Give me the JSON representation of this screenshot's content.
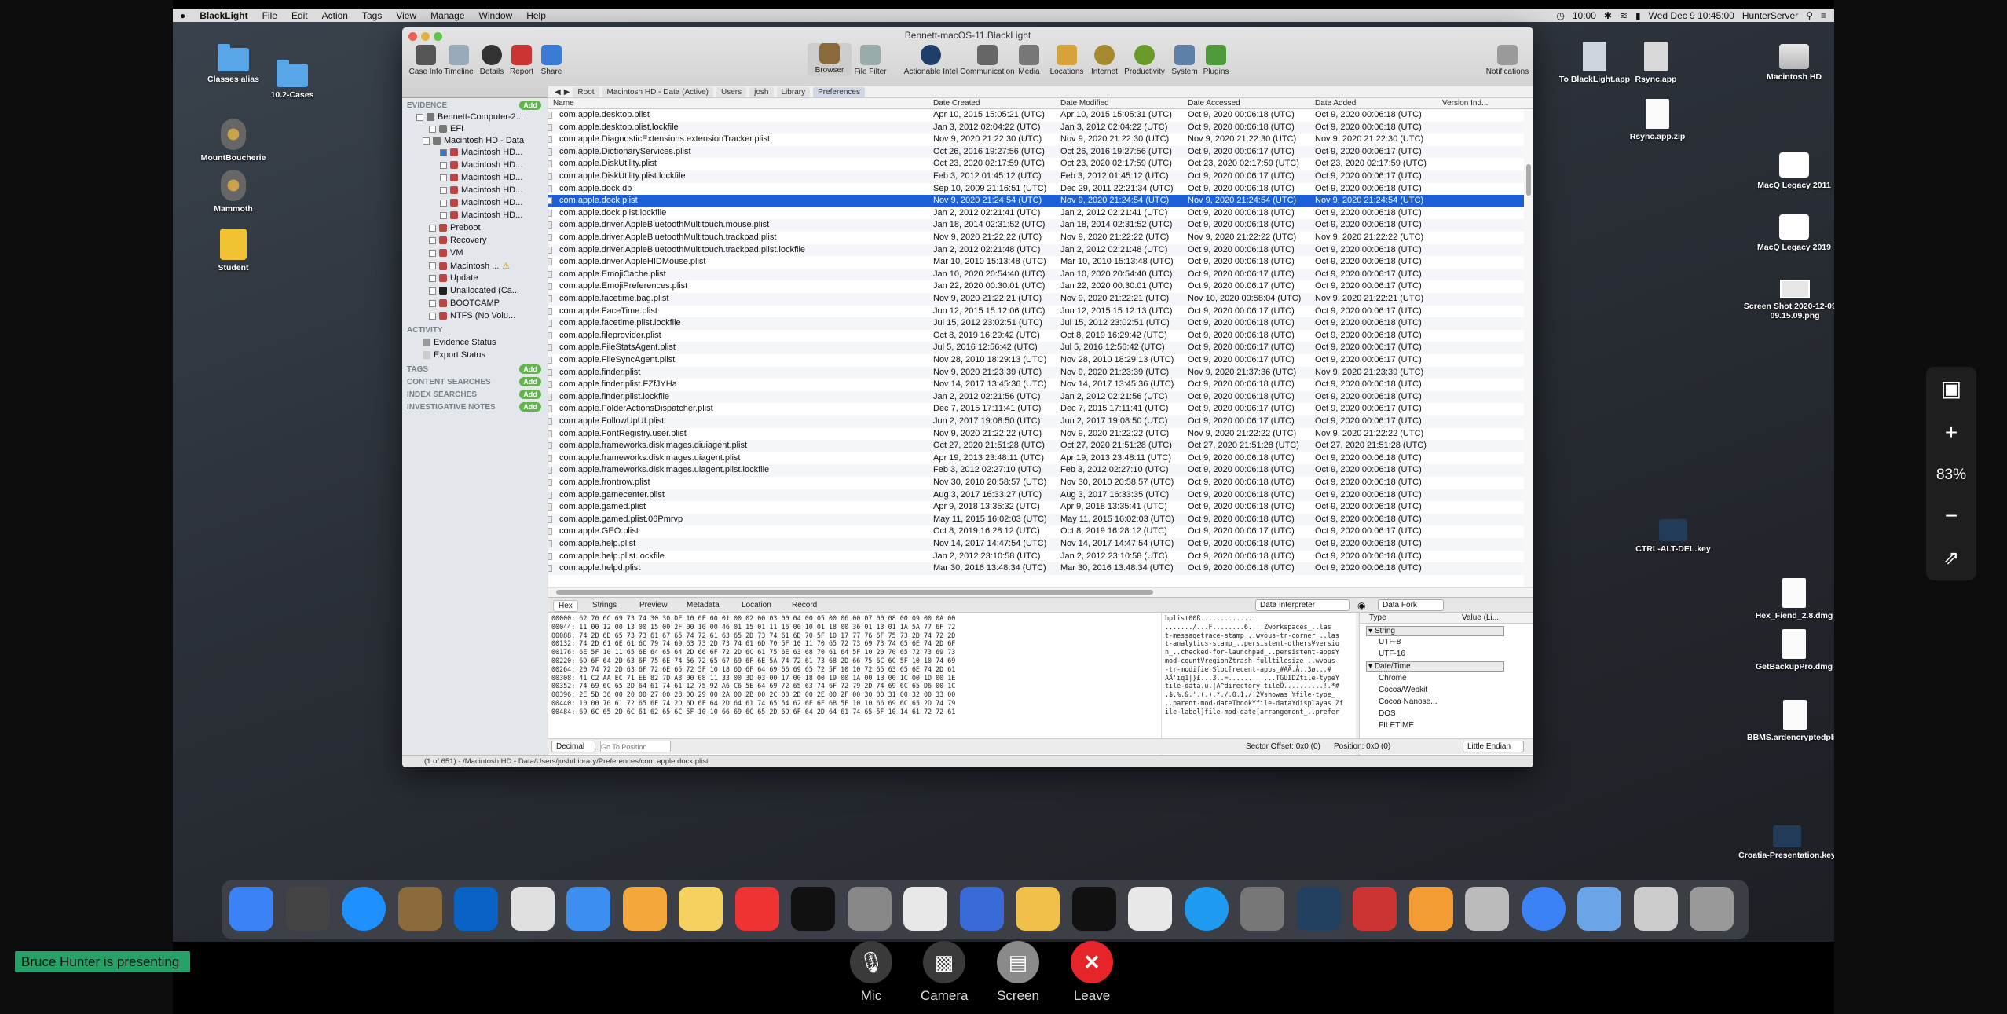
{
  "menubar": {
    "app": "BlackLight",
    "items": [
      "File",
      "Edit",
      "Action",
      "Tags",
      "View",
      "Manage",
      "Window",
      "Help"
    ],
    "clock": "10:00",
    "datetime": "Wed Dec 9  10:45:00",
    "user": "HunterServer"
  },
  "desktop_icons": {
    "classes_alias": "Classes alias",
    "cases": "10.2-Cases",
    "mountboucherie": "MountBoucherie",
    "mammoth": "Mammoth",
    "student": "Student",
    "to_blacklight": "To BlackLight.app",
    "rsync_app": "Rsync.app",
    "rsync_zip": "Rsync.app.zip",
    "macintosh_hd": "Macintosh HD",
    "macq2011": "MacQ Legacy 2011",
    "macq2019": "MacQ Legacy 2019",
    "screenshot": "Screen Shot 2020-12-09 at 09.15.09.png",
    "ctrl_alt_del": "CTRL-ALT-DEL.key",
    "hexfiend": "Hex_Fiend_2.8.dmg",
    "getbackup": "GetBackupPro.dmg",
    "bbms": "BBMS.ardencryptedplist",
    "croatia": "Croatia-Presentation.key"
  },
  "window": {
    "title": "Bennett-macOS-11.BlackLight",
    "toolbar_left": [
      "Case Info",
      "Timeline",
      "Details",
      "Report",
      "Share"
    ],
    "toolbar_mid": [
      "Browser",
      "File Filter",
      "Actionable Intel",
      "Communication",
      "Media",
      "Locations",
      "Internet",
      "Productivity",
      "System",
      "Plugins"
    ],
    "toolbar_right": "Notifications",
    "breadcrumbs": [
      "Root",
      "Macintosh HD - Data (Active)",
      "Users",
      "josh",
      "Library",
      "Preferences"
    ]
  },
  "sidebar": {
    "evidence": "EVIDENCE",
    "add": "Add",
    "tree": [
      "Bennett-Computer-2...",
      "EFI",
      "Macintosh HD - Data",
      "Macintosh HD...",
      "Macintosh HD...",
      "Macintosh HD...",
      "Macintosh HD...",
      "Macintosh HD...",
      "Macintosh HD...",
      "Preboot",
      "Recovery",
      "VM",
      "Macintosh ...",
      "Update",
      "Unallocated (Ca...",
      "BOOTCAMP",
      "NTFS (No Volu..."
    ],
    "activity": "ACTIVITY",
    "evidence_status": "Evidence Status",
    "export_status": "Export Status",
    "tags": "TAGS",
    "content_searches": "CONTENT SEARCHES",
    "index_searches": "INDEX SEARCHES",
    "investigative_notes": "INVESTIGATIVE NOTES"
  },
  "table": {
    "headers": [
      "Name",
      "Date Created",
      "Date Modified",
      "Date Accessed",
      "Date Added",
      "Version Ind..."
    ],
    "rows": [
      [
        "com.apple.desktop.plist",
        "Apr 10, 2015 15:05:21 (UTC)",
        "Apr 10, 2015 15:05:31 (UTC)",
        "Oct 9, 2020 00:06:18 (UTC)",
        "Oct 9, 2020 00:06:18 (UTC)"
      ],
      [
        "com.apple.desktop.plist.lockfile",
        "Jan 3, 2012 02:04:22 (UTC)",
        "Jan 3, 2012 02:04:22 (UTC)",
        "Oct 9, 2020 00:06:18 (UTC)",
        "Oct 9, 2020 00:06:18 (UTC)"
      ],
      [
        "com.apple.DiagnosticExtensions.extensionTracker.plist",
        "Nov 9, 2020 21:22:30 (UTC)",
        "Nov 9, 2020 21:22:30 (UTC)",
        "Nov 9, 2020 21:22:30 (UTC)",
        "Nov 9, 2020 21:22:30 (UTC)"
      ],
      [
        "com.apple.DictionaryServices.plist",
        "Oct 26, 2016 19:27:56 (UTC)",
        "Oct 26, 2016 19:27:56 (UTC)",
        "Oct 9, 2020 00:06:17 (UTC)",
        "Oct 9, 2020 00:06:17 (UTC)"
      ],
      [
        "com.apple.DiskUtility.plist",
        "Oct 23, 2020 02:17:59 (UTC)",
        "Oct 23, 2020 02:17:59 (UTC)",
        "Oct 23, 2020 02:17:59 (UTC)",
        "Oct 23, 2020 02:17:59 (UTC)"
      ],
      [
        "com.apple.DiskUtility.plist.lockfile",
        "Feb 3, 2012 01:45:12 (UTC)",
        "Feb 3, 2012 01:45:12 (UTC)",
        "Oct 9, 2020 00:06:17 (UTC)",
        "Oct 9, 2020 00:06:17 (UTC)"
      ],
      [
        "com.apple.dock.db",
        "Sep 10, 2009 21:16:51 (UTC)",
        "Dec 29, 2011 22:21:34 (UTC)",
        "Oct 9, 2020 00:06:18 (UTC)",
        "Oct 9, 2020 00:06:18 (UTC)"
      ],
      [
        "com.apple.dock.plist",
        "Nov 9, 2020 21:24:54 (UTC)",
        "Nov 9, 2020 21:24:54 (UTC)",
        "Nov 9, 2020 21:24:54 (UTC)",
        "Nov 9, 2020 21:24:54 (UTC)"
      ],
      [
        "com.apple.dock.plist.lockfile",
        "Jan 2, 2012 02:21:41 (UTC)",
        "Jan 2, 2012 02:21:41 (UTC)",
        "Oct 9, 2020 00:06:18 (UTC)",
        "Oct 9, 2020 00:06:18 (UTC)"
      ],
      [
        "com.apple.driver.AppleBluetoothMultitouch.mouse.plist",
        "Jan 18, 2014 02:31:52 (UTC)",
        "Jan 18, 2014 02:31:52 (UTC)",
        "Oct 9, 2020 00:06:18 (UTC)",
        "Oct 9, 2020 00:06:18 (UTC)"
      ],
      [
        "com.apple.driver.AppleBluetoothMultitouch.trackpad.plist",
        "Nov 9, 2020 21:22:22 (UTC)",
        "Nov 9, 2020 21:22:22 (UTC)",
        "Nov 9, 2020 21:22:22 (UTC)",
        "Nov 9, 2020 21:22:22 (UTC)"
      ],
      [
        "com.apple.driver.AppleBluetoothMultitouch.trackpad.plist.lockfile",
        "Jan 2, 2012 02:21:48 (UTC)",
        "Jan 2, 2012 02:21:48 (UTC)",
        "Oct 9, 2020 00:06:18 (UTC)",
        "Oct 9, 2020 00:06:18 (UTC)"
      ],
      [
        "com.apple.driver.AppleHIDMouse.plist",
        "Mar 10, 2010 15:13:48 (UTC)",
        "Mar 10, 2010 15:13:48 (UTC)",
        "Oct 9, 2020 00:06:18 (UTC)",
        "Oct 9, 2020 00:06:18 (UTC)"
      ],
      [
        "com.apple.EmojiCache.plist",
        "Jan 10, 2020 20:54:40 (UTC)",
        "Jan 10, 2020 20:54:40 (UTC)",
        "Oct 9, 2020 00:06:17 (UTC)",
        "Oct 9, 2020 00:06:17 (UTC)"
      ],
      [
        "com.apple.EmojiPreferences.plist",
        "Jan 22, 2020 00:30:01 (UTC)",
        "Jan 22, 2020 00:30:01 (UTC)",
        "Oct 9, 2020 00:06:17 (UTC)",
        "Oct 9, 2020 00:06:17 (UTC)"
      ],
      [
        "com.apple.facetime.bag.plist",
        "Nov 9, 2020 21:22:21 (UTC)",
        "Nov 9, 2020 21:22:21 (UTC)",
        "Nov 10, 2020 00:58:04 (UTC)",
        "Nov 9, 2020 21:22:21 (UTC)"
      ],
      [
        "com.apple.FaceTime.plist",
        "Jun 12, 2015 15:12:06 (UTC)",
        "Jun 12, 2015 15:12:13 (UTC)",
        "Oct 9, 2020 00:06:17 (UTC)",
        "Oct 9, 2020 00:06:17 (UTC)"
      ],
      [
        "com.apple.facetime.plist.lockfile",
        "Jul 15, 2012 23:02:51 (UTC)",
        "Jul 15, 2012 23:02:51 (UTC)",
        "Oct 9, 2020 00:06:18 (UTC)",
        "Oct 9, 2020 00:06:18 (UTC)"
      ],
      [
        "com.apple.fileprovider.plist",
        "Oct 8, 2019 16:29:42 (UTC)",
        "Oct 8, 2019 16:29:42 (UTC)",
        "Oct 9, 2020 00:06:18 (UTC)",
        "Oct 9, 2020 00:06:18 (UTC)"
      ],
      [
        "com.apple.FileStatsAgent.plist",
        "Jul 5, 2016 12:56:42 (UTC)",
        "Jul 5, 2016 12:56:42 (UTC)",
        "Oct 9, 2020 00:06:17 (UTC)",
        "Oct 9, 2020 00:06:17 (UTC)"
      ],
      [
        "com.apple.FileSyncAgent.plist",
        "Nov 28, 2010 18:29:13 (UTC)",
        "Nov 28, 2010 18:29:13 (UTC)",
        "Oct 9, 2020 00:06:17 (UTC)",
        "Oct 9, 2020 00:06:17 (UTC)"
      ],
      [
        "com.apple.finder.plist",
        "Nov 9, 2020 21:23:39 (UTC)",
        "Nov 9, 2020 21:23:39 (UTC)",
        "Nov 9, 2020 21:37:36 (UTC)",
        "Nov 9, 2020 21:23:39 (UTC)"
      ],
      [
        "com.apple.finder.plist.FZfJYHa",
        "Nov 14, 2017 13:45:36 (UTC)",
        "Nov 14, 2017 13:45:36 (UTC)",
        "Oct 9, 2020 00:06:18 (UTC)",
        "Oct 9, 2020 00:06:18 (UTC)"
      ],
      [
        "com.apple.finder.plist.lockfile",
        "Jan 2, 2012 02:21:56 (UTC)",
        "Jan 2, 2012 02:21:56 (UTC)",
        "Oct 9, 2020 00:06:18 (UTC)",
        "Oct 9, 2020 00:06:18 (UTC)"
      ],
      [
        "com.apple.FolderActionsDispatcher.plist",
        "Dec 7, 2015 17:11:41 (UTC)",
        "Dec 7, 2015 17:11:41 (UTC)",
        "Oct 9, 2020 00:06:17 (UTC)",
        "Oct 9, 2020 00:06:17 (UTC)"
      ],
      [
        "com.apple.FollowUpUI.plist",
        "Jun 2, 2017 19:08:50 (UTC)",
        "Jun 2, 2017 19:08:50 (UTC)",
        "Oct 9, 2020 00:06:17 (UTC)",
        "Oct 9, 2020 00:06:17 (UTC)"
      ],
      [
        "com.apple.FontRegistry.user.plist",
        "Nov 9, 2020 21:22:22 (UTC)",
        "Nov 9, 2020 21:22:22 (UTC)",
        "Nov 9, 2020 21:22:22 (UTC)",
        "Nov 9, 2020 21:22:22 (UTC)"
      ],
      [
        "com.apple.frameworks.diskimages.diuiagent.plist",
        "Oct 27, 2020 21:51:28 (UTC)",
        "Oct 27, 2020 21:51:28 (UTC)",
        "Oct 27, 2020 21:51:28 (UTC)",
        "Oct 27, 2020 21:51:28 (UTC)"
      ],
      [
        "com.apple.frameworks.diskimages.uiagent.plist",
        "Apr 19, 2013 23:48:11 (UTC)",
        "Apr 19, 2013 23:48:11 (UTC)",
        "Oct 9, 2020 00:06:18 (UTC)",
        "Oct 9, 2020 00:06:18 (UTC)"
      ],
      [
        "com.apple.frameworks.diskimages.uiagent.plist.lockfile",
        "Feb 3, 2012 02:27:10 (UTC)",
        "Feb 3, 2012 02:27:10 (UTC)",
        "Oct 9, 2020 00:06:18 (UTC)",
        "Oct 9, 2020 00:06:18 (UTC)"
      ],
      [
        "com.apple.frontrow.plist",
        "Nov 30, 2010 20:58:57 (UTC)",
        "Nov 30, 2010 20:58:57 (UTC)",
        "Oct 9, 2020 00:06:18 (UTC)",
        "Oct 9, 2020 00:06:18 (UTC)"
      ],
      [
        "com.apple.gamecenter.plist",
        "Aug 3, 2017 16:33:27 (UTC)",
        "Aug 3, 2017 16:33:35 (UTC)",
        "Oct 9, 2020 00:06:18 (UTC)",
        "Oct 9, 2020 00:06:18 (UTC)"
      ],
      [
        "com.apple.gamed.plist",
        "Apr 9, 2018 13:35:32 (UTC)",
        "Apr 9, 2018 13:35:41 (UTC)",
        "Oct 9, 2020 00:06:18 (UTC)",
        "Oct 9, 2020 00:06:18 (UTC)"
      ],
      [
        "com.apple.gamed.plist.06Pmrvp",
        "May 11, 2015 16:02:03 (UTC)",
        "May 11, 2015 16:02:03 (UTC)",
        "Oct 9, 2020 00:06:18 (UTC)",
        "Oct 9, 2020 00:06:18 (UTC)"
      ],
      [
        "com.apple.GEO.plist",
        "Oct 8, 2019 16:28:12 (UTC)",
        "Oct 8, 2019 16:28:12 (UTC)",
        "Oct 9, 2020 00:06:17 (UTC)",
        "Oct 9, 2020 00:06:17 (UTC)"
      ],
      [
        "com.apple.help.plist",
        "Nov 14, 2017 14:47:54 (UTC)",
        "Nov 14, 2017 14:47:54 (UTC)",
        "Oct 9, 2020 00:06:18 (UTC)",
        "Oct 9, 2020 00:06:18 (UTC)"
      ],
      [
        "com.apple.help.plist.lockfile",
        "Jan 2, 2012 23:10:58 (UTC)",
        "Jan 2, 2012 23:10:58 (UTC)",
        "Oct 9, 2020 00:06:18 (UTC)",
        "Oct 9, 2020 00:06:18 (UTC)"
      ],
      [
        "com.apple.helpd.plist",
        "Mar 30, 2016 13:48:34 (UTC)",
        "Mar 30, 2016 13:48:34 (UTC)",
        "Oct 9, 2020 00:06:18 (UTC)",
        "Oct 9, 2020 00:06:18 (UTC)"
      ]
    ]
  },
  "viewer_tabs": [
    "Hex",
    "Strings",
    "Preview",
    "Metadata",
    "Location",
    "Record"
  ],
  "data_interpreter": "Data Interpreter",
  "data_fork": "Data Fork",
  "hex_rows": [
    "00000: 62 70 6C 69 73 74 30 30 DF 10 0F 00 01 00 02 00 03 00 04 00 05 00 06 00 07 00 08 00 09 00 0A 00",
    "00044: 11 00 12 00 13 00 15 00 2F 00 10 00 46 01 15 01 11 16 00 10 01 18 00 36 01 13 01 1A 5A 77 6F 72",
    "00088: 74 2D 6D 65 73 73 61 67 65 74 72 61 63 65 2D 73 74 61 6D 70 5F 10 17 77 76 6F 75 73 2D 74 72 2D",
    "00132: 74 2D 61 6E 61 6C 79 74 69 63 73 2D 73 74 61 6D 70 5F 10 11 70 65 72 73 69 73 74 65 6E 74 2D 6F",
    "00176: 6E 5F 10 11 65 6E 64 65 64 2D 66 6F 72 2D 6C 61 75 6E 63 68 70 61 64 5F 10 20 70 65 72 73 69 73",
    "00220: 6D 6F 64 2D 63 6F 75 6E 74 56 72 65 67 69 6F 6E 5A 74 72 61 73 68 2D 66 75 6C 6C 5F 10 10 74 69",
    "00264: 20 74 72 2D 63 6F 72 6E 65 72 5F 10 18 6D 6F 64 69 66 69 65 72 5F 10 10 72 65 63 65 6E 74 2D 61",
    "00308: 41 C2 AA EC 71 EE 82 7D A3 00 08 11 33 00 3D 03 00 17 00 18 00 19 00 1A 00 1B 00 1C 00 1D 00 1E",
    "00352: 74 69 6C 65 2D 64 61 74 61 12 75 92 A6 C6 5E 64 69 72 65 63 74 6F 72 79 2D 74 69 6C 65 D6 00 1C",
    "00396: 2E 5D 36 00 20 00 27 00 28 00 29 00 2A 00 2B 00 2C 00 2D 00 2E 00 2F 00 30 00 31 00 32 00 33 00",
    "00440: 10 00 70 61 72 65 6E 74 2D 6D 6F 64 2D 64 61 74 65 54 62 6F 6F 6B 5F 10 10 66 69 6C 65 2D 74 79",
    "00484: 69 6C 65 2D 6C 61 62 65 6C 5F 10 10 66 69 6C 65 2D 6D 6F 64 2D 64 61 74 65 5F 10 14 61 72 72 61"
  ],
  "ascii_rows": [
    "bplist00ß..............",
    "......./...F........6....Zworkspaces_..las",
    "t-messagetrace-stamp_..wvous-tr-corner_..las",
    "t-analytics-stamp_..persistent-others¥versio",
    "n_..checked-for-launchpad_..persistent-appsY",
    "mod-countVregionZtrash-fulltilesize_..wvous",
    "-tr-modifierSloc[recent-apps_#AÄ.Å..3ø...#",
    "AÄ'iq1|}£...3..=............TGUIDZtile-typeY",
    "tile-data.u.|A^directory-tileÖ..........!.*#",
    ".$.%.&.'.(.).*./.0.1./.2Vshowas Yfile-type_",
    "..parent-mod-dateTbookYfile-dataYdisplayas Zf",
    "ile-label]file-mod-date[arrangement_..prefer"
  ],
  "interpreter": {
    "col_type": "Type",
    "col_value": "Value (Li...",
    "string_group": "String",
    "string_items": [
      "UTF-8",
      "UTF-16"
    ],
    "datetime_group": "Date/Time",
    "datetime_items": [
      "Chrome",
      "Cocoa/Webkit",
      "Cocoa Nanose...",
      "DOS",
      "FILETIME"
    ]
  },
  "hex_footer": {
    "decimal": "Decimal",
    "goto_placeholder": "Go To Position",
    "sector_offset": "Sector Offset: 0x0 (0)",
    "position": "Position: 0x0 (0)",
    "endian": "Little Endian"
  },
  "status": {
    "path": "(1 of 651)  -  /Macintosh HD - Data/Users/josh/Library/Preferences/com.apple.dock.plist"
  },
  "zoom": {
    "level": "83%"
  },
  "presenter": {
    "label": "Bruce Hunter is presenting"
  },
  "controls": {
    "mic": "Mic",
    "camera": "Camera",
    "screen": "Screen",
    "leave": "Leave"
  },
  "colors": {
    "selection": "#1d5fd6",
    "add_badge": "#5fb54a",
    "presenting_bg": "#26a269",
    "leave_red": "#e5252a"
  }
}
